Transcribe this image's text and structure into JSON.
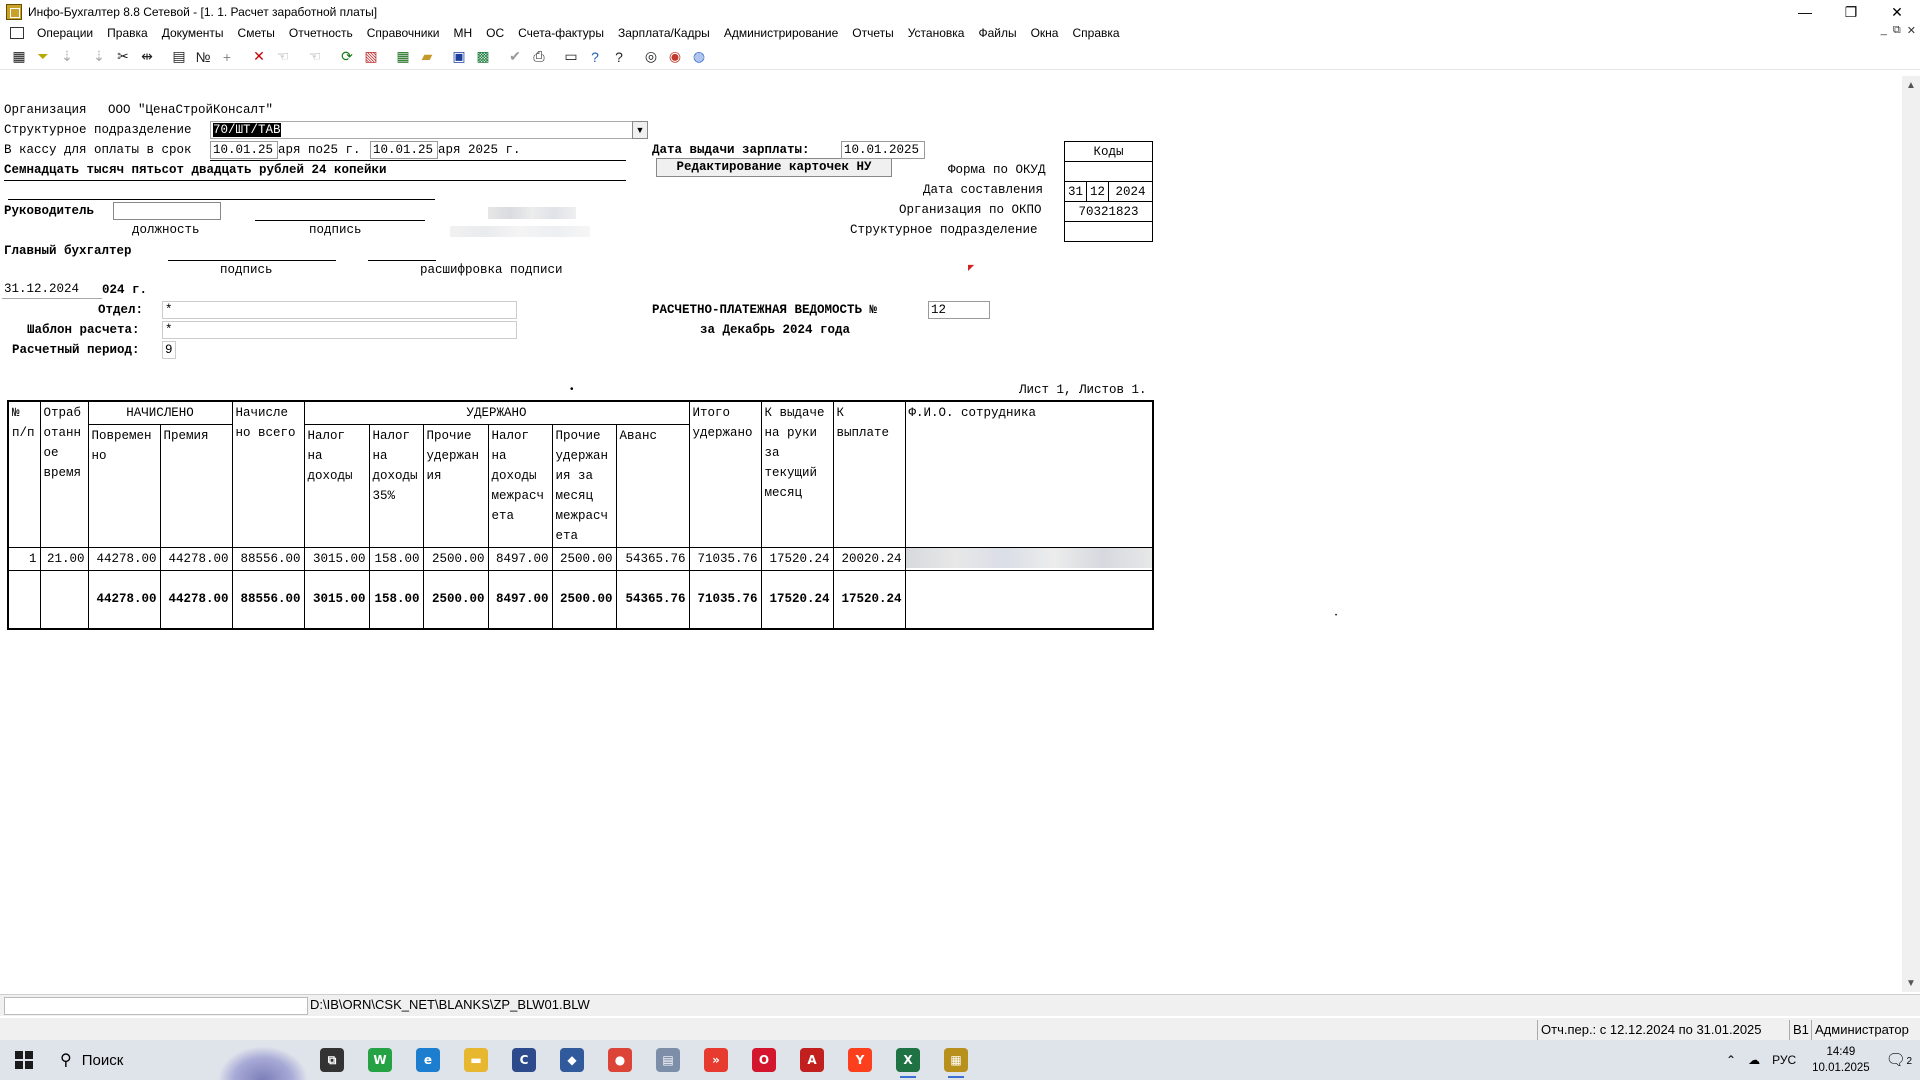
{
  "window": {
    "title": "Инфо-Бухгалтер 8.8 Сетевой - [1. 1. Расчет заработной платы]",
    "controls": {
      "minimize": "—",
      "restore": "❐",
      "close": "✕"
    }
  },
  "menu": [
    "Операции",
    "Правка",
    "Документы",
    "Сметы",
    "Отчетность",
    "Справочники",
    "МН",
    "ОС",
    "Счета-фактуры",
    "Зарплата/Кадры",
    "Администрирование",
    "Отчеты",
    "Установка",
    "Файлы",
    "Окна",
    "Справка"
  ],
  "toolbar_icons": [
    "table-icon",
    "filter-icon",
    "sort-asc-icon",
    "sort-desc-icon",
    "cut-icon",
    "split-icon",
    "paste-icon",
    "numbering-icon",
    "add-icon",
    "delete-icon",
    "pick-icon",
    "pick-all-icon",
    "refresh-icon",
    "pdf-icon",
    "calc-icon",
    "open-folder-icon",
    "save-icon",
    "excel-icon",
    "check-icon",
    "print-icon",
    "preview-icon",
    "help-icon",
    "context-help-icon",
    "navigator-icon",
    "support-icon",
    "web-icon"
  ],
  "form": {
    "tab_title": "Редактирование карточек НУ",
    "org_label": "Организация",
    "org_name": "ООО \"ЦенаСтройКонсалт\"",
    "division_label": "Структурное подразделение",
    "division_value": "70/ШТ/ТАВ",
    "cash_label": "В кассу для оплаты в срок",
    "cash_from": "10.01.25",
    "cash_mid": "аря по25 г.",
    "cash_to": "10.01.25",
    "cash_tail": "аря 2025 г.",
    "amount_words": "Семнадцать тысяч пятьсот двадцать рублей 24 копейки",
    "head_label": "Руководитель",
    "position_caption": "должность",
    "signature_caption": "подпись",
    "chief_label": "Главный бухгалтер",
    "signature_caption2": "подпись",
    "decode_caption": "расшифровка подписи",
    "date_field": "31.12.2024",
    "date_tail": "024 г.",
    "dept_label": "Отдел:",
    "dept_value": "*",
    "template_label": "Шаблон расчета:",
    "template_value": "*",
    "period_label": "Расчетный период:",
    "period_value": "9",
    "pay_date_label": "Дата выдачи зарплаты:",
    "pay_date_value": "10.01.2025",
    "statement_title": "РАСЧЕТНО-ПЛАТЕЖНАЯ ВЕДОМОСТЬ №",
    "statement_no": "12",
    "statement_period": "за Декабрь 2024 года",
    "sheet_info": "Лист 1, Листов 1."
  },
  "codes": {
    "header": "Коды",
    "rows": [
      {
        "label": "Форма по ОКУД",
        "value": ""
      },
      {
        "label": "Дата составления",
        "d": "31",
        "m": "12",
        "y": "2024"
      },
      {
        "label": "Организация по ОКПО",
        "value": "70321823"
      },
      {
        "label": "Структурное подразделение",
        "value": ""
      }
    ]
  },
  "table": {
    "h_no": "№ п/п",
    "h_worked": "Отраб отанн ое время",
    "h_accrued": "НАЧИСЛЕНО",
    "h_timebased": "Повремен но",
    "h_bonus": "Премия",
    "h_accrued_total": "Начисле но всего",
    "h_withheld": "УДЕРЖАНО",
    "h_tax": "Налог на доходы",
    "h_tax35": "Налог на доходы 35%",
    "h_other": "Прочие удержан ия",
    "h_tax_inter": "Налог на доходы межрасч ета",
    "h_other_inter": "Прочие удержан ия за месяц межрасч ета",
    "h_advance": "Аванс",
    "h_withheld_total": "Итого удержано",
    "h_to_issue": "К выдаче на руки за текущий месяц",
    "h_to_pay": "К выплате",
    "h_fio": "Ф.И.О. сотрудника",
    "row": {
      "no": "1",
      "worked": "21.00",
      "timebased": "44278.00",
      "bonus": "44278.00",
      "accrued_total": "88556.00",
      "tax": "3015.00",
      "tax35": "158.00",
      "other": "2500.00",
      "tax_inter": "8497.00",
      "other_inter": "2500.00",
      "advance": "54365.76",
      "withheld_total": "71035.76",
      "to_issue": "17520.24",
      "to_pay": "20020.24"
    },
    "totals": {
      "timebased": "44278.00",
      "bonus": "44278.00",
      "accrued_total": "88556.00",
      "tax": "3015.00",
      "tax35": "158.00",
      "other": "2500.00",
      "tax_inter": "8497.00",
      "other_inter": "2500.00",
      "advance": "54365.76",
      "withheld_total": "71035.76",
      "to_issue": "17520.24",
      "to_pay": "17520.24"
    }
  },
  "status": {
    "path": "D:\\IB\\ORN\\CSK_NET\\BLANKS\\ZP_BLW01.BLW",
    "period": "Отч.пер.: с 12.12.2024 по 31.01.2025",
    "code": "В1",
    "user": "Администратор"
  },
  "taskbar": {
    "search_placeholder": "Поиск",
    "apps": [
      {
        "name": "task-view-icon",
        "glyph": "⧉",
        "color": "#333333"
      },
      {
        "name": "whatsapp-icon",
        "glyph": "W",
        "color": "#25a244"
      },
      {
        "name": "edge-icon",
        "glyph": "e",
        "color": "#1d7ecf"
      },
      {
        "name": "explorer-icon",
        "glyph": "▬",
        "color": "#e8b730"
      },
      {
        "name": "ccleaner-icon",
        "glyph": "C",
        "color": "#2c4a8c"
      },
      {
        "name": "program-icon",
        "glyph": "◆",
        "color": "#315a9c"
      },
      {
        "name": "chrome-icon",
        "glyph": "●",
        "color": "#db4437"
      },
      {
        "name": "printer-app-icon",
        "glyph": "▤",
        "color": "#7d8ea8"
      },
      {
        "name": "anydesk-icon",
        "glyph": "»",
        "color": "#e63b2e"
      },
      {
        "name": "opera-icon",
        "glyph": "O",
        "color": "#d3162d"
      },
      {
        "name": "pdf-reader-icon",
        "glyph": "A",
        "color": "#c21f1f"
      },
      {
        "name": "yandex-icon",
        "glyph": "Y",
        "color": "#fc3f1d"
      },
      {
        "name": "excel-app-icon",
        "glyph": "X",
        "color": "#1f7244"
      },
      {
        "name": "infobuh-app-icon",
        "glyph": "▦",
        "color": "#b8901c"
      }
    ],
    "lang": "РУС",
    "time": "14:49",
    "date": "10.01.2025",
    "notifications": "2"
  }
}
